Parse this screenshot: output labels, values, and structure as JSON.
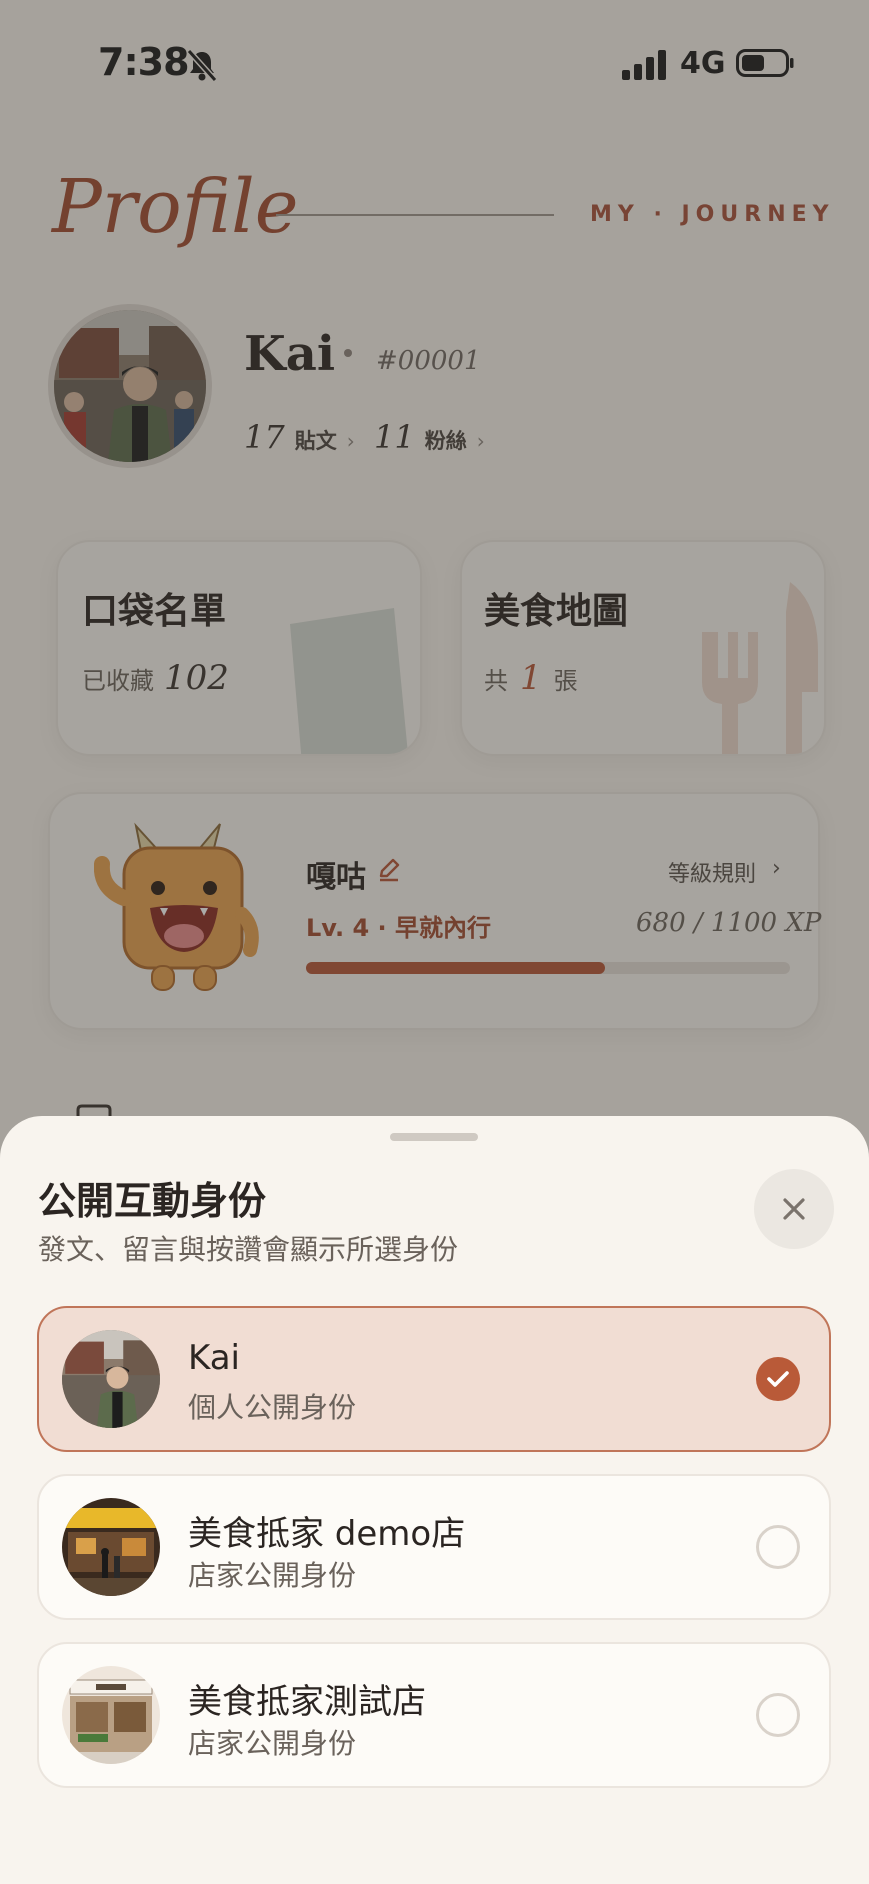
{
  "status_bar": {
    "time": "7:38",
    "network": "4G"
  },
  "header": {
    "title": "Profile",
    "tagline": "MY · JOURNEY"
  },
  "user": {
    "name": "Kai",
    "id": "#00001",
    "posts_count": "17",
    "posts_label": "貼文",
    "followers_count": "11",
    "followers_label": "粉絲"
  },
  "cards": {
    "pocket_list": {
      "title": "口袋名單",
      "prefix": "已收藏",
      "count": "102"
    },
    "food_map": {
      "title": "美食地圖",
      "prefix": "共",
      "count": "1",
      "suffix": "張"
    }
  },
  "pet": {
    "name": "嘎咕",
    "level_rules": "等級規則",
    "level_text": "Lv. 4 · 早就內行",
    "xp_text": "680 / 1100 XP",
    "xp_current": 680,
    "xp_max": 1100
  },
  "sheet": {
    "title": "公開互動身份",
    "subtitle": "發文、留言與按讚會顯示所選身份",
    "options": [
      {
        "name": "Kai",
        "role": "個人公開身份",
        "selected": true
      },
      {
        "name": "美食抵家 demo店",
        "role": "店家公開身份",
        "selected": false
      },
      {
        "name": "美食抵家測試店",
        "role": "店家公開身份",
        "selected": false
      }
    ]
  },
  "colors": {
    "accent": "#b65536",
    "background": "#f6f1ea",
    "selected_bg": "#f1ddd3"
  }
}
